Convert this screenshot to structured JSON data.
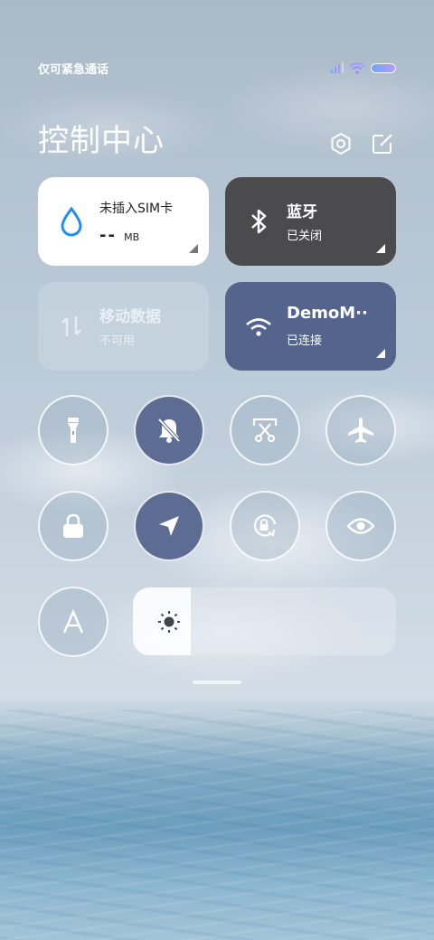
{
  "status_bar": {
    "carrier_text": "仅可紧急通话",
    "icons": [
      "signal-icon",
      "wifi-icon",
      "battery-icon"
    ]
  },
  "header": {
    "title": "控制中心",
    "icons": [
      "settings-icon",
      "edit-icon"
    ]
  },
  "cards": {
    "data_usage": {
      "title": "未插入SIM卡",
      "value": "--",
      "unit": "MB",
      "icon": "water-drop-icon"
    },
    "bluetooth": {
      "title": "蓝牙",
      "status": "已关闭",
      "icon": "bluetooth-icon",
      "state": "off"
    },
    "mobile_data": {
      "title": "移动数据",
      "status": "不可用",
      "icon": "data-arrows-icon",
      "state": "disabled"
    },
    "wifi": {
      "title": "DemoM··",
      "status": "已连接",
      "icon": "wifi-icon",
      "state": "on"
    }
  },
  "toggles": [
    {
      "name": "flashlight",
      "icon": "flashlight-icon",
      "state": "off"
    },
    {
      "name": "mute",
      "icon": "bell-off-icon",
      "state": "on"
    },
    {
      "name": "screenshot",
      "icon": "scissors-icon",
      "state": "off"
    },
    {
      "name": "airplane",
      "icon": "airplane-icon",
      "state": "off"
    },
    {
      "name": "lock-screen",
      "icon": "lock-icon",
      "state": "off"
    },
    {
      "name": "location",
      "icon": "location-arrow-icon",
      "state": "on"
    },
    {
      "name": "rotation-lock",
      "icon": "rotation-lock-icon",
      "state": "off"
    },
    {
      "name": "reading-mode",
      "icon": "eye-icon",
      "state": "off"
    },
    {
      "name": "auto-brightness",
      "icon": "letter-a-icon",
      "state": "off"
    }
  ],
  "brightness": {
    "level": 0.22,
    "icon": "sun-icon"
  },
  "colors": {
    "card_white": "#ffffff",
    "card_dark": "#4b4a4c",
    "card_wifi": "#55648c",
    "toggle_on": "#5d6c92",
    "drop_blue": "#1e8cf0"
  }
}
